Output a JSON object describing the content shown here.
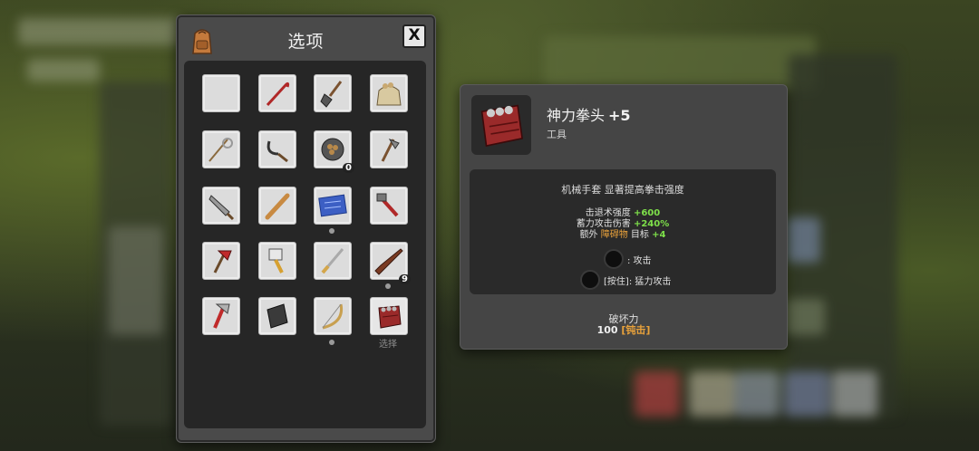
{
  "inventory": {
    "title": "选项",
    "close_label": "X",
    "select_label": "选择",
    "slots": [
      {
        "icon": "empty-slot"
      },
      {
        "icon": "crowbar-icon"
      },
      {
        "icon": "shovel-icon"
      },
      {
        "icon": "sack-icon"
      },
      {
        "icon": "rope-whip-icon"
      },
      {
        "icon": "sickle-icon"
      },
      {
        "icon": "food-bowl-icon",
        "count": "0"
      },
      {
        "icon": "hatchet-icon"
      },
      {
        "icon": "machete-icon"
      },
      {
        "icon": "baseball-bat-icon"
      },
      {
        "icon": "blueprint-map-icon"
      },
      {
        "icon": "pipe-wrench-icon"
      },
      {
        "icon": "fire-axe-icon"
      },
      {
        "icon": "brush-icon"
      },
      {
        "icon": "katana-icon"
      },
      {
        "icon": "rifle-icon",
        "count": "9"
      },
      {
        "icon": "red-axe-icon"
      },
      {
        "icon": "riot-shield-icon"
      },
      {
        "icon": "bow-icon"
      },
      {
        "icon": "power-fist-icon"
      }
    ]
  },
  "detail": {
    "name": "神力拳头",
    "level": "+5",
    "category": "工具",
    "description": "机械手套 显著提高拳击强度",
    "stats": {
      "line1_label": "击退术强度",
      "line1_value": "+600",
      "line2_label": "蓄力攻击伤害",
      "line2_value": "+240%",
      "line3_prefix": "额外",
      "line3_highlight": "障碍物",
      "line3_label": "目标",
      "line3_value": "+4"
    },
    "actions": {
      "attack": ": 攻击",
      "heavy_hold": "[按住]",
      "heavy_label": ": 猛力攻击"
    },
    "destruction_label": "破坏力",
    "destruction_value": "100",
    "destruction_type": "钝击"
  },
  "colors": {
    "green": "#7ee04a",
    "orange": "#e9a23b",
    "panel": "#4a4a4a"
  }
}
